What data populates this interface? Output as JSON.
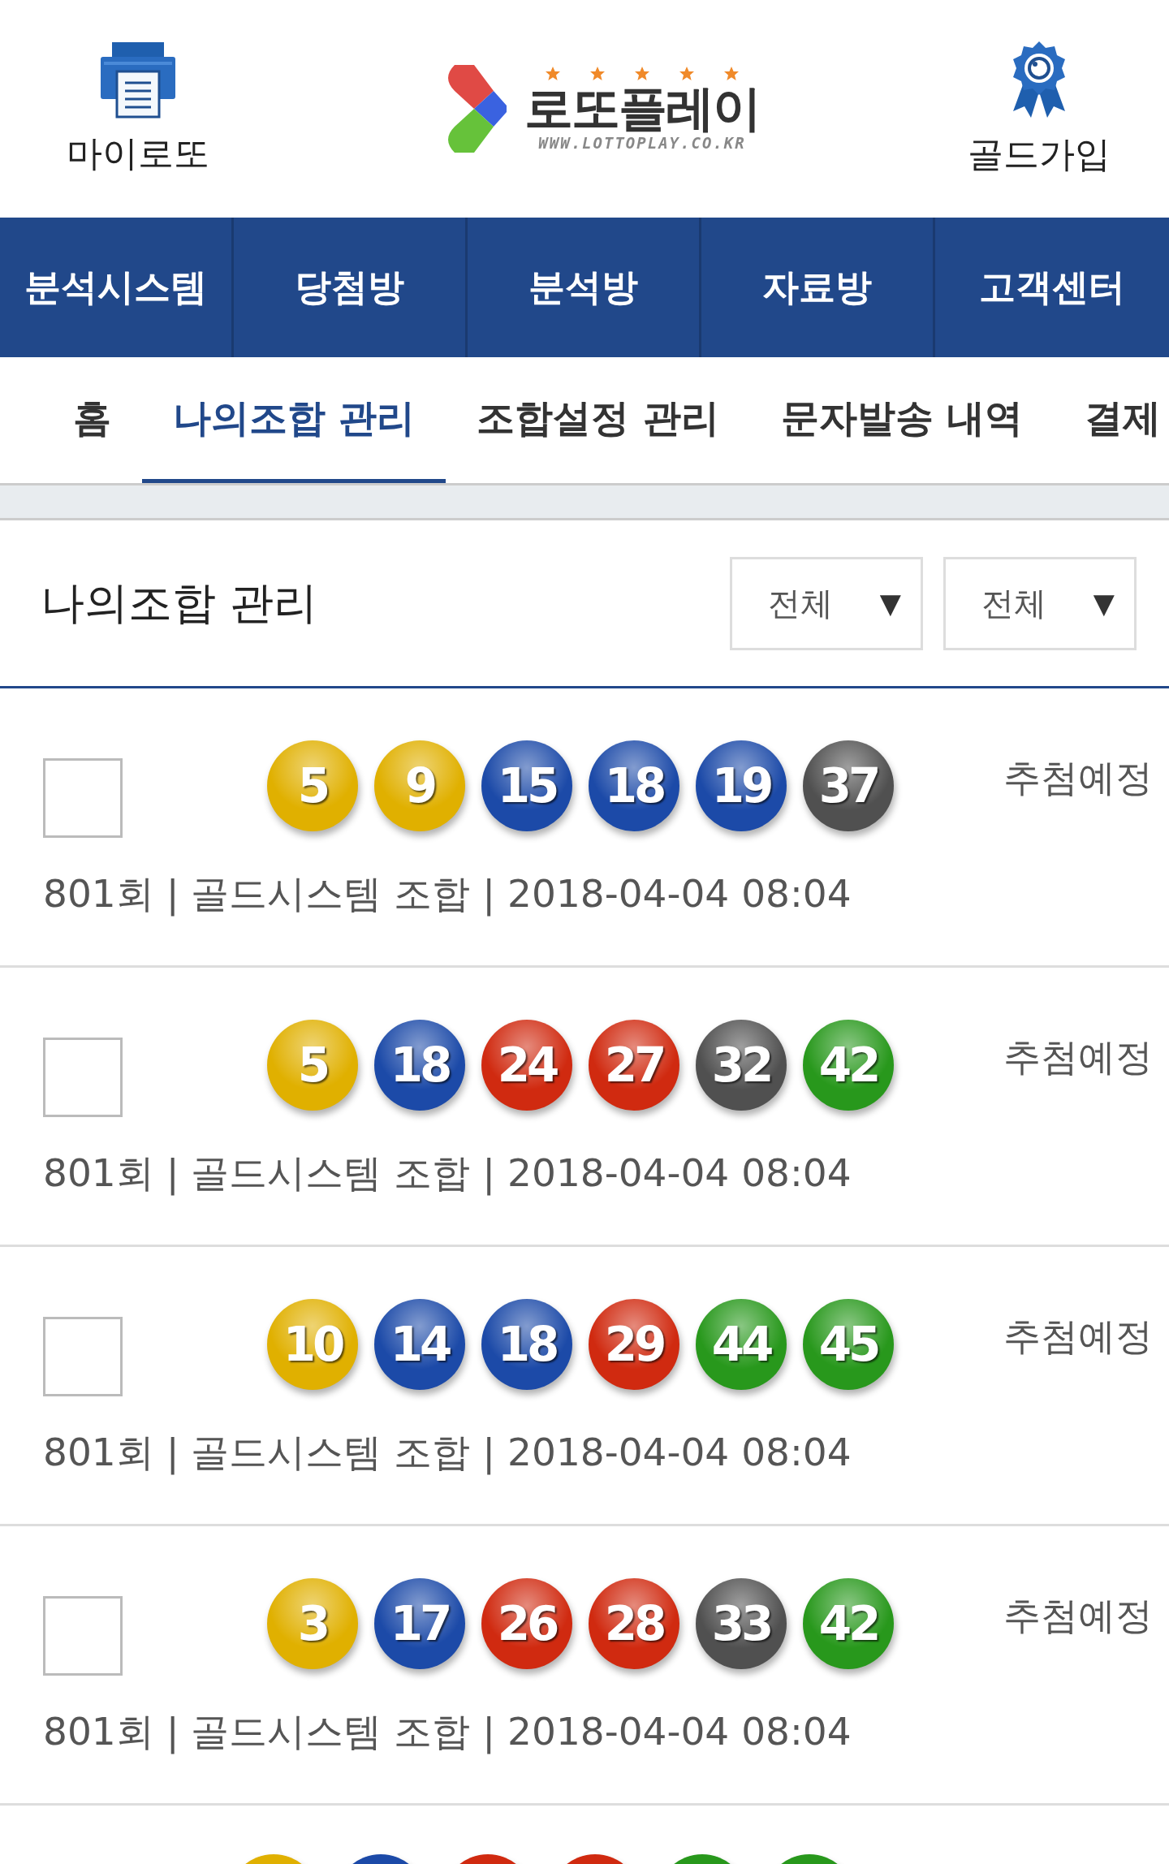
{
  "header": {
    "left_link": "마이로또",
    "logo": {
      "title": "로또플레이",
      "url": "WWW.LOTTOPLAY.CO.KR"
    },
    "right_link": "골드가입"
  },
  "nav": [
    "분석시스템",
    "당첨방",
    "분석방",
    "자료방",
    "고객센터"
  ],
  "tabs": [
    {
      "label": "홈",
      "selected": false
    },
    {
      "label": "나의조합 관리",
      "selected": true
    },
    {
      "label": "조합설정 관리",
      "selected": false
    },
    {
      "label": "문자발송 내역",
      "selected": false
    },
    {
      "label": "결제",
      "selected": false
    }
  ],
  "section": {
    "title": "나의조합 관리",
    "filters": [
      {
        "value": "전체",
        "arrow": "▼"
      },
      {
        "value": "전체",
        "arrow": "▼"
      }
    ]
  },
  "combinations": [
    {
      "checked": false,
      "balls": [
        {
          "number": "5",
          "color": "#e0b000"
        },
        {
          "number": "9",
          "color": "#e0b000"
        },
        {
          "number": "15",
          "color": "#1c4aa8"
        },
        {
          "number": "18",
          "color": "#1c4aa8"
        },
        {
          "number": "19",
          "color": "#1c4aa8"
        },
        {
          "number": "37",
          "color": "#505050"
        }
      ],
      "status": "추첨예정",
      "info": "801회 | 골드시스템 조합 | 2018-04-04 08:04"
    },
    {
      "checked": false,
      "balls": [
        {
          "number": "5",
          "color": "#e0b000"
        },
        {
          "number": "18",
          "color": "#1c4aa8"
        },
        {
          "number": "24",
          "color": "#d02a10"
        },
        {
          "number": "27",
          "color": "#d02a10"
        },
        {
          "number": "32",
          "color": "#505050"
        },
        {
          "number": "42",
          "color": "#28981c"
        }
      ],
      "status": "추첨예정",
      "info": "801회 | 골드시스템 조합 | 2018-04-04 08:04"
    },
    {
      "checked": false,
      "balls": [
        {
          "number": "10",
          "color": "#e0b000"
        },
        {
          "number": "14",
          "color": "#1c4aa8"
        },
        {
          "number": "18",
          "color": "#1c4aa8"
        },
        {
          "number": "29",
          "color": "#d02a10"
        },
        {
          "number": "44",
          "color": "#28981c"
        },
        {
          "number": "45",
          "color": "#28981c"
        }
      ],
      "status": "추첨예정",
      "info": "801회 | 골드시스템 조합 | 2018-04-04 08:04"
    },
    {
      "checked": false,
      "balls": [
        {
          "number": "3",
          "color": "#e0b000"
        },
        {
          "number": "17",
          "color": "#1c4aa8"
        },
        {
          "number": "26",
          "color": "#d02a10"
        },
        {
          "number": "28",
          "color": "#d02a10"
        },
        {
          "number": "33",
          "color": "#505050"
        },
        {
          "number": "42",
          "color": "#28981c"
        }
      ],
      "status": "추첨예정",
      "info": "801회 | 골드시스템 조합 | 2018-04-04 08:04"
    },
    {
      "kind": "partial",
      "balls": [
        {
          "color": "#e0b000"
        },
        {
          "color": "#1c4aa8"
        },
        {
          "color": "#d02a10"
        },
        {
          "color": "#d02a10"
        },
        {
          "color": "#28981c"
        },
        {
          "color": "#28981c"
        }
      ]
    }
  ]
}
